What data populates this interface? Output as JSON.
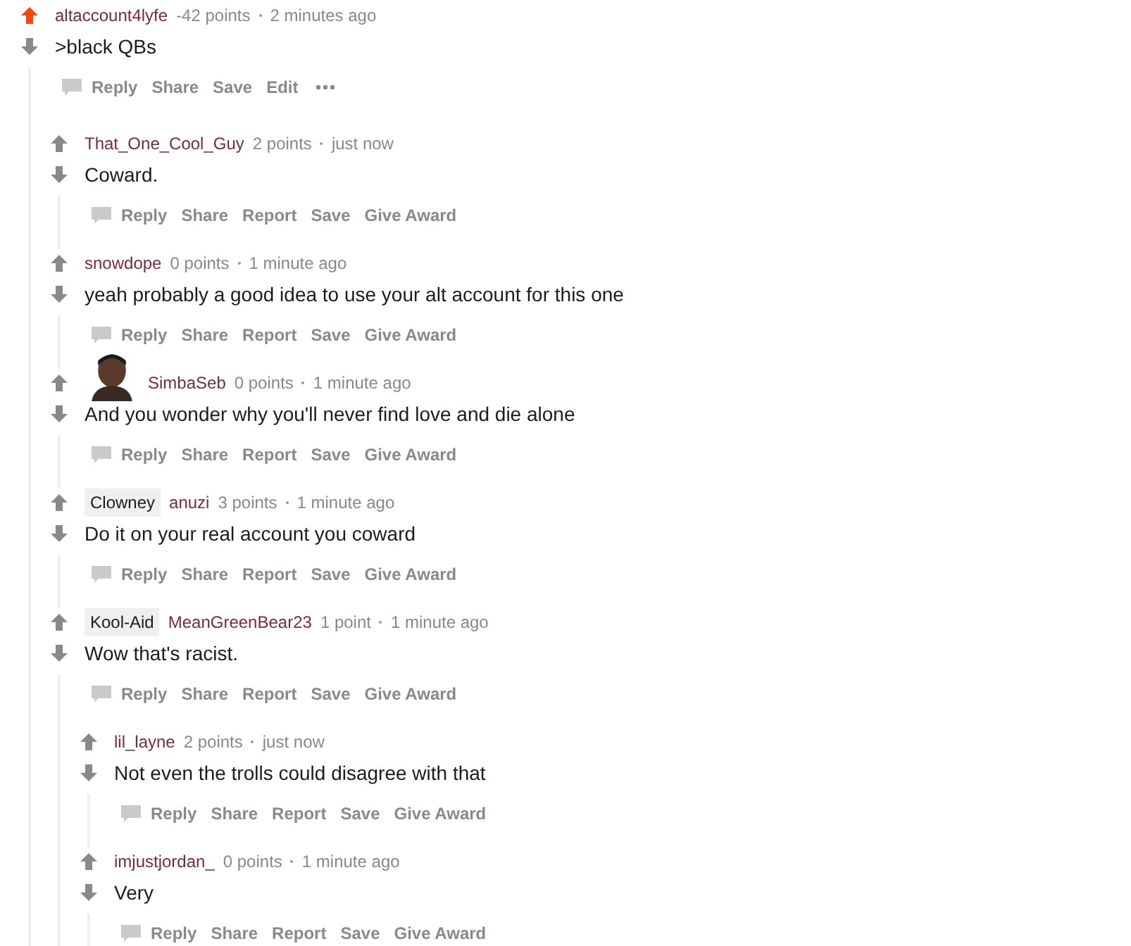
{
  "comments": [
    {
      "author": "altaccount4lyfe",
      "points": "-42 points",
      "time": "2 minutes ago",
      "body": ">black QBs",
      "upvoted": true,
      "actions": [
        "Reply",
        "Share",
        "Save",
        "Edit"
      ],
      "more_menu": true,
      "children": [
        {
          "author": "That_One_Cool_Guy",
          "points": "2 points",
          "time": "just now",
          "body": "Coward.",
          "upvoted": false,
          "actions": [
            "Reply",
            "Share",
            "Report",
            "Save",
            "Give Award"
          ]
        },
        {
          "author": "snowdope",
          "points": "0 points",
          "time": "1 minute ago",
          "body": "yeah probably a good idea to use your alt account for this one",
          "upvoted": false,
          "actions": [
            "Reply",
            "Share",
            "Report",
            "Save",
            "Give Award"
          ]
        },
        {
          "author": "SimbaSeb",
          "points": "0 points",
          "time": "1 minute ago",
          "body": "And you wonder why you'll never find love and die alone",
          "upvoted": false,
          "actions": [
            "Reply",
            "Share",
            "Report",
            "Save",
            "Give Award"
          ]
        },
        {
          "author": "anuzi",
          "flair": "Clowney",
          "points": "3 points",
          "time": "1 minute ago",
          "body": "Do it on your real account you coward",
          "upvoted": false,
          "actions": [
            "Reply",
            "Share",
            "Report",
            "Save",
            "Give Award"
          ]
        },
        {
          "author": "MeanGreenBear23",
          "flair": "Kool-Aid",
          "points": "1 point",
          "time": "1 minute ago",
          "body": "Wow that's racist.",
          "upvoted": false,
          "actions": [
            "Reply",
            "Share",
            "Report",
            "Save",
            "Give Award"
          ],
          "children": [
            {
              "author": "lil_layne",
              "points": "2 points",
              "time": "just now",
              "body": "Not even the trolls could disagree with that",
              "upvoted": false,
              "actions": [
                "Reply",
                "Share",
                "Report",
                "Save",
                "Give Award"
              ]
            },
            {
              "author": "imjustjordan_",
              "points": "0 points",
              "time": "1 minute ago",
              "body": "Very",
              "upvoted": false,
              "actions": [
                "Reply",
                "Share",
                "Report",
                "Save",
                "Give Award"
              ]
            }
          ]
        }
      ]
    }
  ]
}
